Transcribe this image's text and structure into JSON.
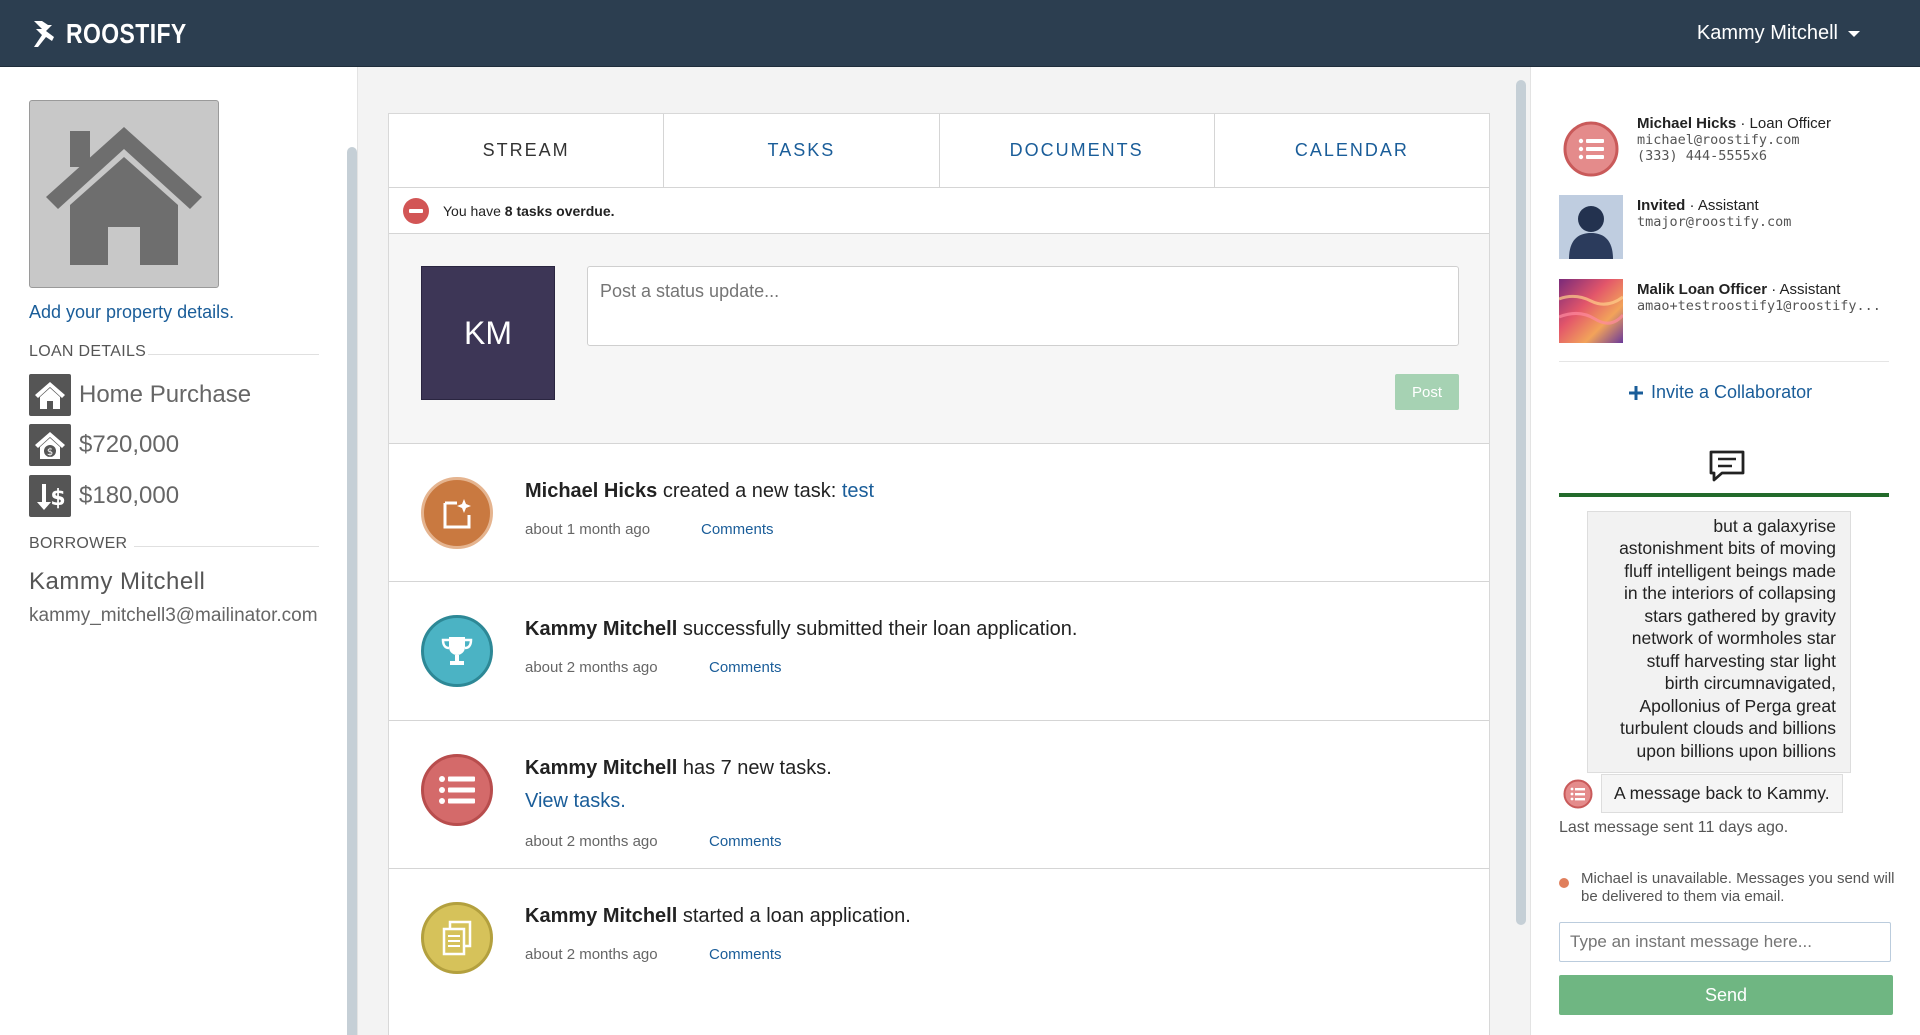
{
  "header": {
    "brand": "ROOSTIFY",
    "user_name": "Kammy Mitchell"
  },
  "left": {
    "add_property": "Add your property details.",
    "loan_details_label": "LOAN DETAILS",
    "loan_items": [
      {
        "icon": "home-icon",
        "value": "Home Purchase"
      },
      {
        "icon": "house-dollar-icon",
        "value": "$720,000"
      },
      {
        "icon": "down-dollar-icon",
        "value": "$180,000"
      }
    ],
    "borrower_label": "BORROWER",
    "borrower_name": "Kammy Mitchell",
    "borrower_email": "kammy_mitchell3@mailinator.com"
  },
  "center": {
    "tabs": [
      "STREAM",
      "TASKS",
      "DOCUMENTS",
      "CALENDAR"
    ],
    "alert": {
      "prefix": "You have ",
      "bold": "8 tasks overdue.",
      "icon": "minus-circle-icon"
    },
    "composer": {
      "avatar_initials": "KM",
      "placeholder": "Post a status update...",
      "post_label": "Post"
    },
    "feed": [
      {
        "icon": "new-task-icon",
        "actor": "Michael Hicks",
        "text": " created a new task: ",
        "link": "test",
        "time": "about 1 month ago",
        "comments": "Comments"
      },
      {
        "icon": "trophy-icon",
        "actor": "Kammy Mitchell",
        "text": " successfully submitted their loan application.",
        "time": "about 2 months ago",
        "comments": "Comments"
      },
      {
        "icon": "task-list-icon",
        "actor": "Kammy Mitchell",
        "text": " has 7 new tasks.",
        "link": "View tasks.",
        "time": "about 2 months ago",
        "comments": "Comments"
      },
      {
        "icon": "documents-icon",
        "actor": "Kammy Mitchell",
        "text": " started a loan application.",
        "time": "about 2 months ago",
        "comments": "Comments"
      }
    ]
  },
  "right": {
    "collaborators": [
      {
        "name": "Michael Hicks",
        "role": " · Loan Officer",
        "email": "michael@roostify.com",
        "phone": "(333) 444-5555x6"
      },
      {
        "name": "Invited",
        "role": " · Assistant",
        "email": "tmajor@roostify.com"
      },
      {
        "name": "Malik Loan Officer",
        "role": " · Assistant",
        "email": "amao+testroostify1@roostify..."
      }
    ],
    "invite_label": "Invite a Collaborator",
    "message_text": "but a galaxyrise astonishment bits of moving fluff intelligent beings made in the interiors of collapsing stars gathered by gravity network of wormholes star stuff harvesting star light birth circumnavigated, Apollonius of Perga great turbulent clouds and billions upon billions upon billions",
    "message_lines": [
      "but a galaxyrise",
      "astonishment bits of moving",
      "fluff intelligent beings made",
      "in the interiors of collapsing",
      "stars gathered by gravity",
      "network of wormholes star",
      "stuff harvesting star light",
      "birth circumnavigated,",
      "Apollonius of Perga great",
      "turbulent clouds and billions",
      "upon billions upon billions"
    ],
    "reply": "A message back to Kammy.",
    "last_message": "Last message sent 11 days ago.",
    "unavailable": "Michael is unavailable. Messages you send will be delivered to them via email.",
    "im_placeholder": "Type an instant message here...",
    "send_label": "Send"
  },
  "colors": {
    "header": "#2c3e50",
    "link": "#1a5d99",
    "send": "#6fb682",
    "alert": "#d25555"
  }
}
